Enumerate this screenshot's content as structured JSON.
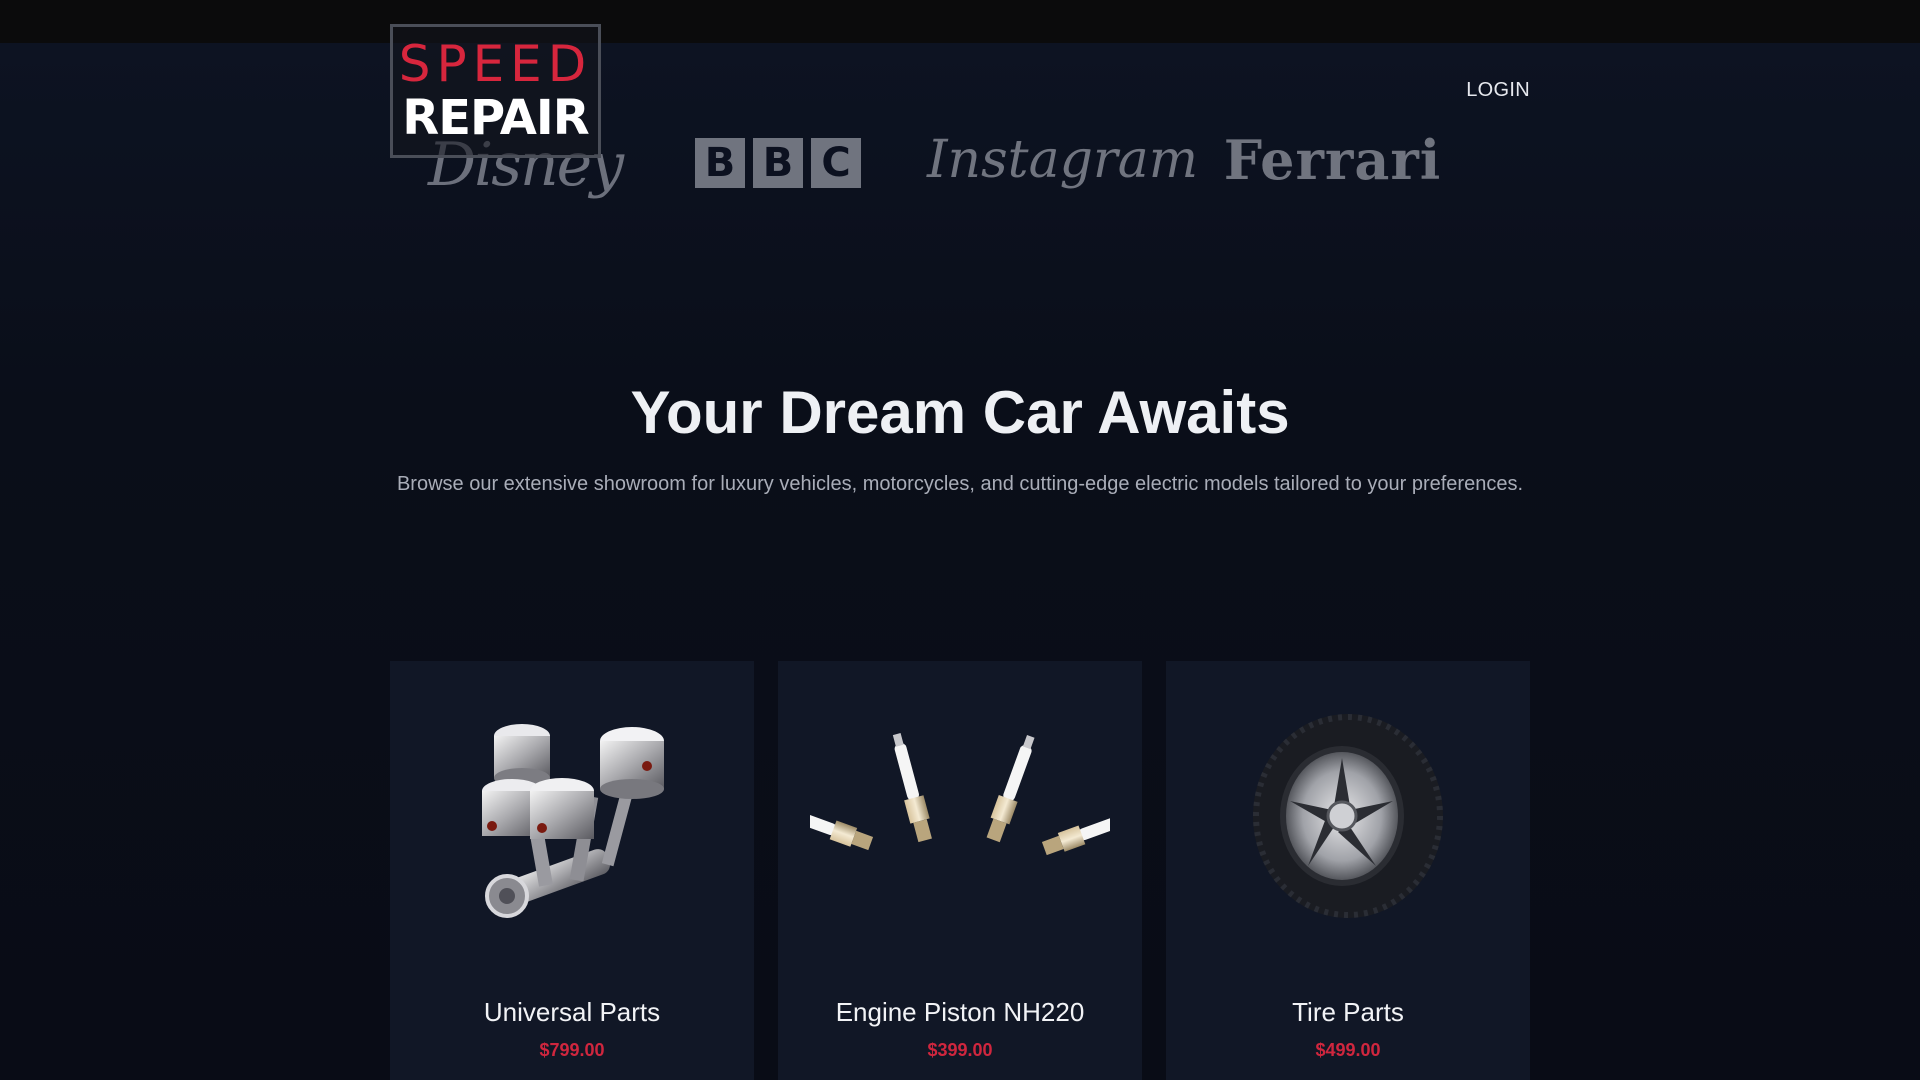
{
  "header": {
    "logo": {
      "line1": "SPEED",
      "line2": "REPAIR"
    },
    "login_label": "LOGIN"
  },
  "brands": [
    {
      "name": "Disney",
      "icon": "disney-logo"
    },
    {
      "name": "BBC",
      "icon": "bbc-logo",
      "letters": [
        "B",
        "B",
        "C"
      ]
    },
    {
      "name": "Instagram",
      "icon": "instagram-logo"
    },
    {
      "name": "Ferrari",
      "icon": "ferrari-logo"
    }
  ],
  "hero": {
    "title": "Your Dream Car Awaits",
    "subtitle": "Browse our extensive showroom for luxury vehicles, motorcycles, and cutting-edge electric models tailored to your preferences."
  },
  "products": [
    {
      "name": "Universal Parts",
      "price": "$799.00",
      "image": "engine-pistons-image"
    },
    {
      "name": "Engine Piston NH220",
      "price": "$399.00",
      "image": "spark-plugs-image"
    },
    {
      "name": "Tire Parts",
      "price": "$499.00",
      "image": "tire-wheel-image"
    }
  ],
  "colors": {
    "accent": "#d0263e",
    "background": "#0a0d17",
    "card": "#111726"
  }
}
